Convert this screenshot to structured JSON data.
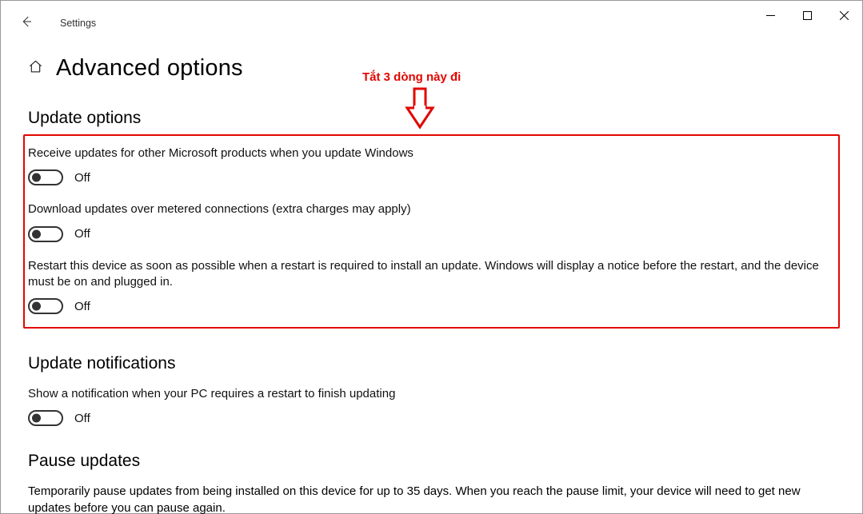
{
  "app_title": "Settings",
  "page_title": "Advanced options",
  "annotation": "Tắt 3 dòng này đi",
  "sections": {
    "update_options": {
      "heading": "Update options",
      "items": [
        {
          "label": "Receive updates for other Microsoft products when you update Windows",
          "state": "Off"
        },
        {
          "label": "Download updates over metered connections (extra charges may apply)",
          "state": "Off"
        },
        {
          "label": "Restart this device as soon as possible when a restart is required to install an update. Windows will display a notice before the restart, and the device must be on and plugged in.",
          "state": "Off"
        }
      ]
    },
    "update_notifications": {
      "heading": "Update notifications",
      "items": [
        {
          "label": "Show a notification when your PC requires a restart to finish updating",
          "state": "Off"
        }
      ]
    },
    "pause_updates": {
      "heading": "Pause updates",
      "paragraph": "Temporarily pause updates from being installed on this device for up to 35 days. When you reach the pause limit, your device will need to get new updates before you can pause again."
    }
  }
}
